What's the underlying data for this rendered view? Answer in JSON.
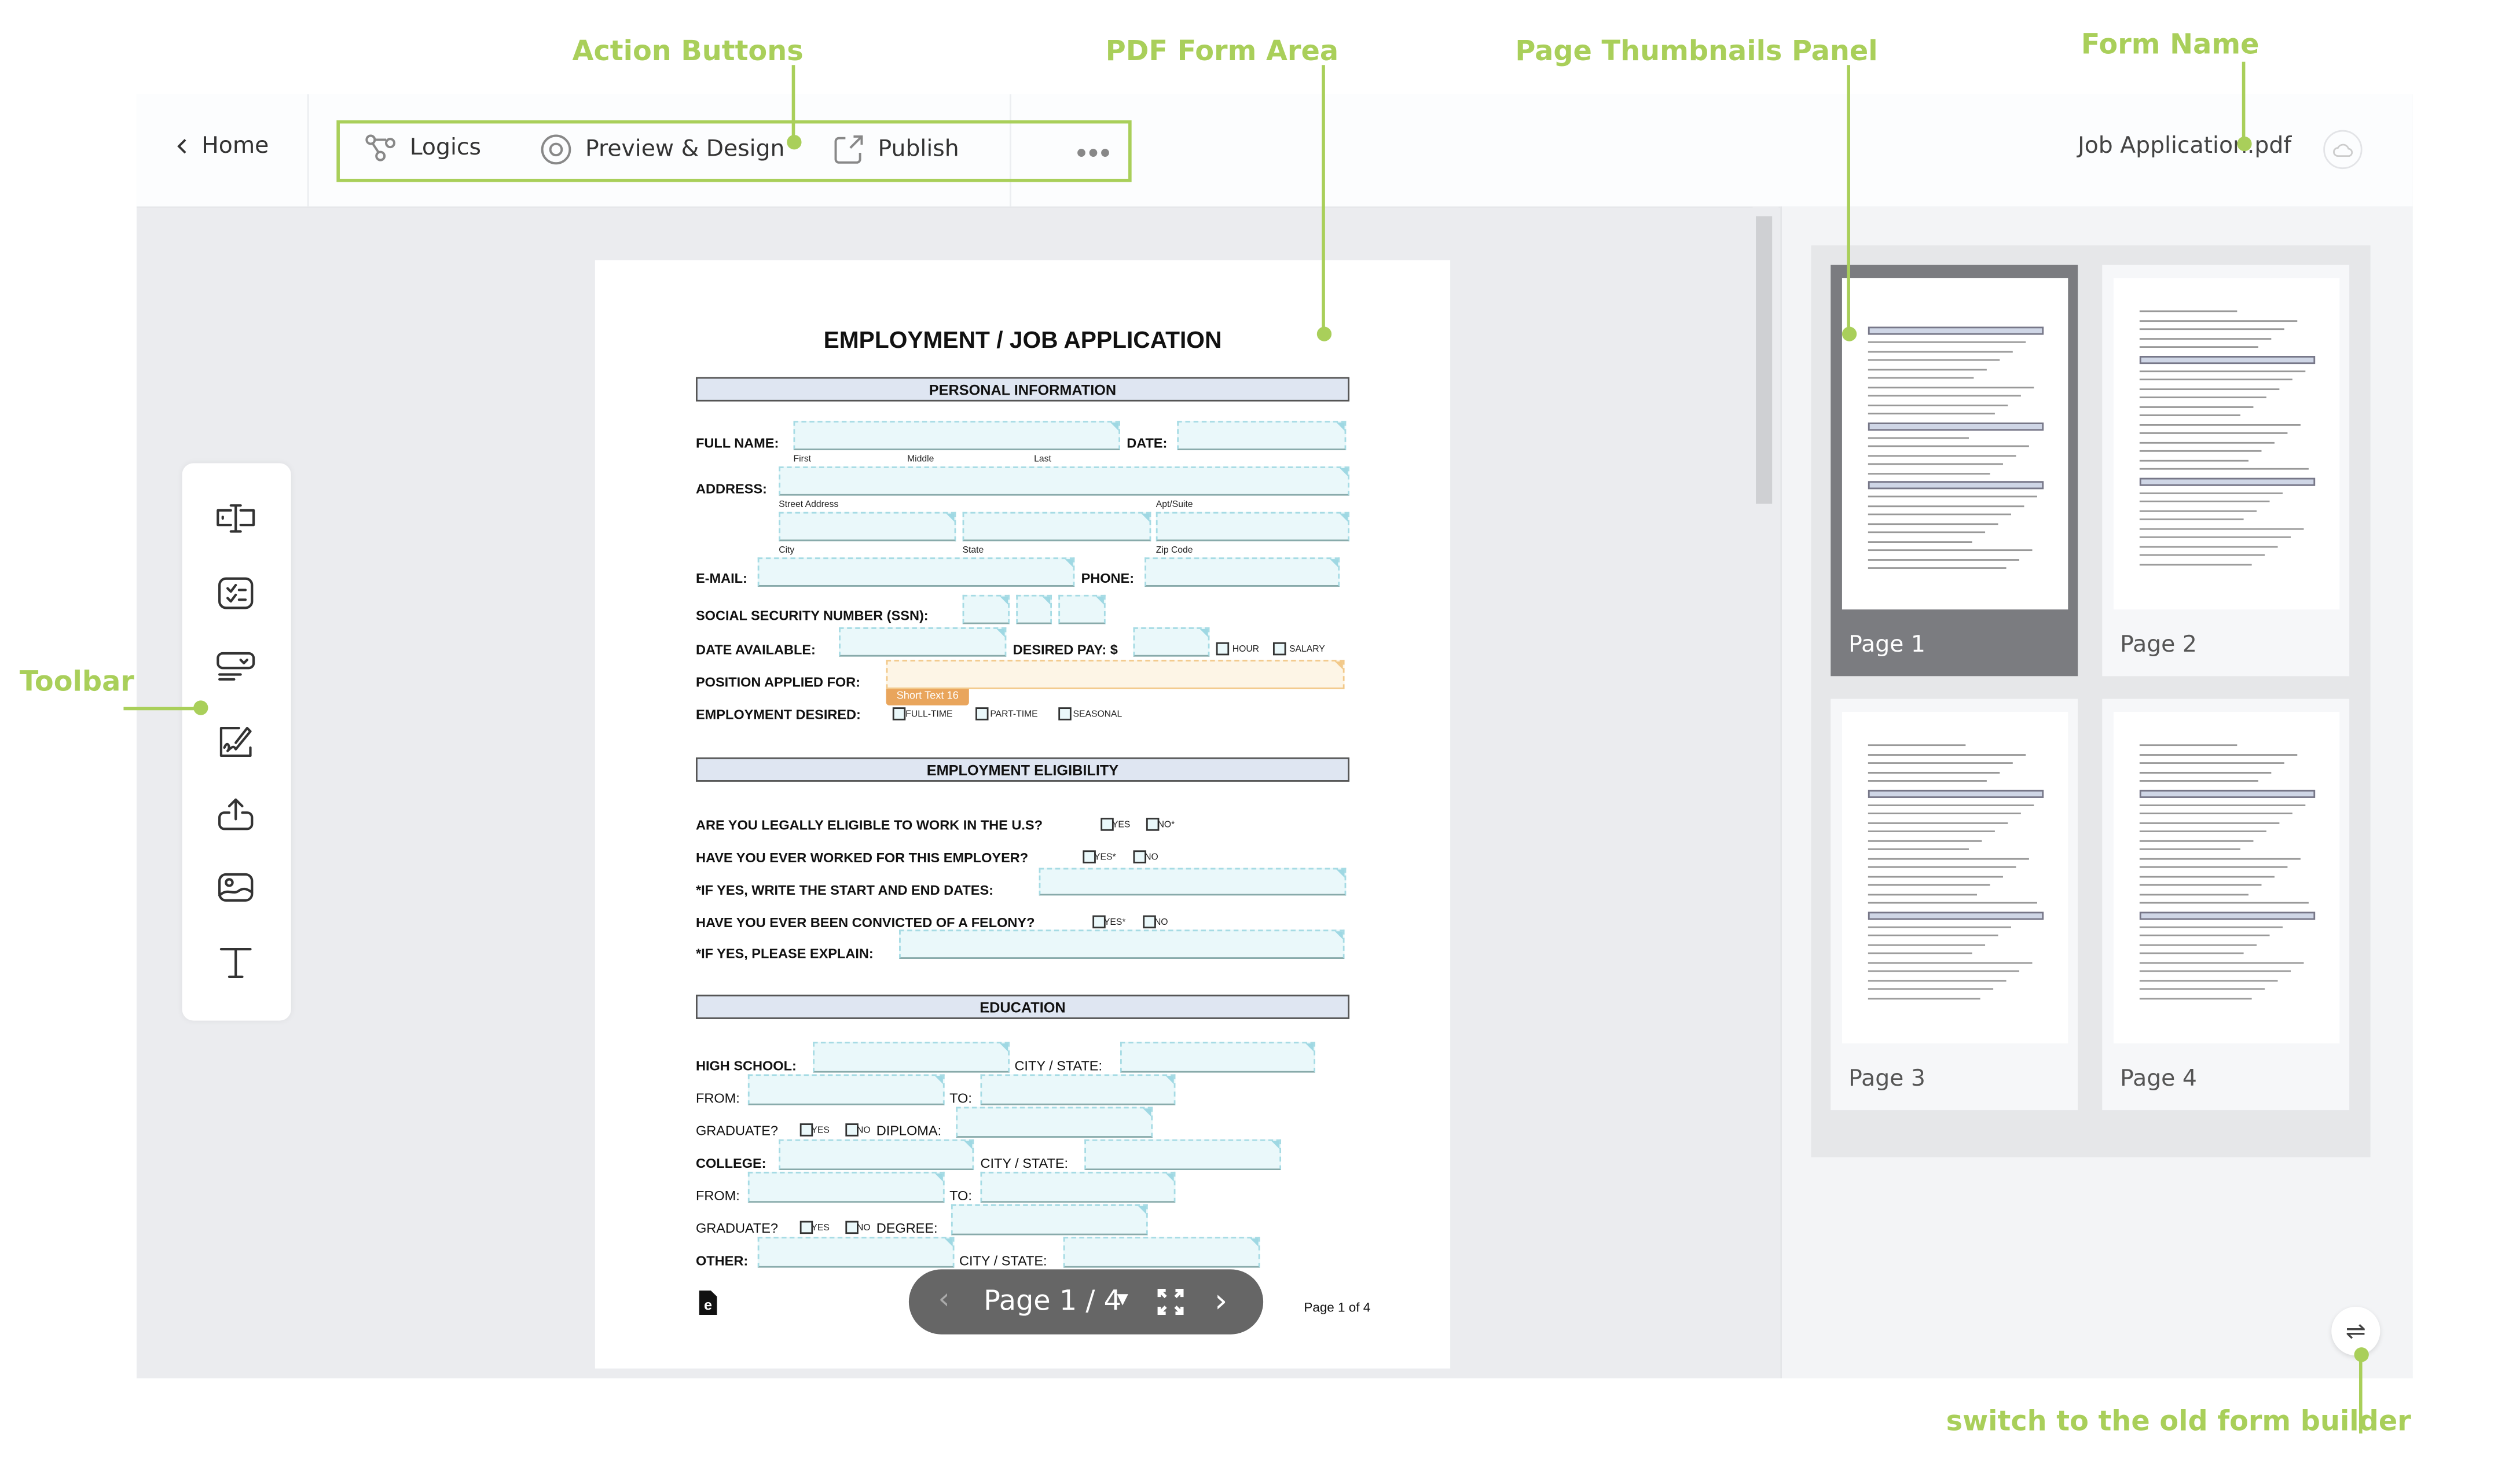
{
  "annotations": {
    "action_buttons": "Action Buttons",
    "pdf_form_area": "PDF Form Area",
    "thumbnails_panel": "Page Thumbnails Panel",
    "form_name": "Form Name",
    "toolbar": "Toolbar",
    "switch_old": "switch to the old form builder"
  },
  "accent_color": "#a9cf5a",
  "header": {
    "home": "Home",
    "logics": "Logics",
    "preview_design": "Preview & Design",
    "publish": "Publish",
    "form_name": "Job Application.pdf"
  },
  "toolbar": {
    "items": [
      "text-field-icon",
      "checklist-icon",
      "dropdown-icon",
      "signature-icon",
      "upload-icon",
      "image-icon",
      "text-icon"
    ]
  },
  "form": {
    "title": "EMPLOYMENT / JOB APPLICATION",
    "sections": {
      "personal": "PERSONAL INFORMATION",
      "eligibility": "EMPLOYMENT ELIGIBILITY",
      "education": "EDUCATION"
    },
    "labels": {
      "full_name": "FULL NAME:",
      "date": "DATE:",
      "address": "ADDRESS:",
      "email": "E-MAIL:",
      "phone": "PHONE:",
      "ssn": "SOCIAL SECURITY NUMBER (SSN):",
      "date_available": "DATE AVAILABLE:",
      "desired_pay": "DESIRED PAY: $",
      "position": "POSITION APPLIED FOR:",
      "employment_desired": "EMPLOYMENT DESIRED:",
      "q1": "ARE YOU LEGALLY ELIGIBLE TO WORK IN THE U.S?",
      "q2": "HAVE YOU EVER WORKED FOR THIS EMPLOYER?",
      "q3": "*IF YES, WRITE THE START AND END DATES:",
      "q4": "HAVE YOU EVER BEEN CONVICTED OF A FELONY?",
      "q5": "*IF YES, PLEASE EXPLAIN:",
      "high_school": "HIGH SCHOOL:",
      "city_state": "CITY / STATE:",
      "from": "FROM:",
      "to": "TO:",
      "graduate": "GRADUATE?",
      "diploma": "DIPLOMA:",
      "college": "COLLEGE:",
      "degree": "DEGREE:",
      "other": "OTHER:"
    },
    "sublabels": {
      "first": "First",
      "middle": "Middle",
      "last": "Last",
      "street": "Street Address",
      "apt": "Apt/Suite",
      "city": "City",
      "state": "State",
      "zip": "Zip Code"
    },
    "options": {
      "hour": "HOUR",
      "salary": "SALARY",
      "full_time": "FULL-TIME",
      "part_time": "PART-TIME",
      "seasonal": "SEASONAL",
      "yes": "YES",
      "no": "NO",
      "yes_star": "YES*",
      "no_star": "NO*"
    },
    "selected_field_tag": "Short Text 16",
    "footer": "Page 1 of 4"
  },
  "pager": {
    "label": "Page 1 / 4"
  },
  "thumbnails": [
    {
      "label": "Page 1",
      "selected": true
    },
    {
      "label": "Page 2",
      "selected": false
    },
    {
      "label": "Page 3",
      "selected": false
    },
    {
      "label": "Page 4",
      "selected": false
    }
  ]
}
